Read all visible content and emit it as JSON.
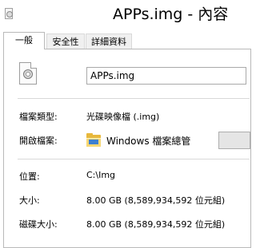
{
  "window": {
    "title": "APPs.img - 內容"
  },
  "tabs": [
    {
      "label": "一般",
      "active": true
    },
    {
      "label": "安全性",
      "active": false
    },
    {
      "label": "詳細資料",
      "active": false
    }
  ],
  "file": {
    "name": "APPs.img",
    "icon": "disc-image-file-icon"
  },
  "properties": {
    "type_label": "檔案類型:",
    "type_value": "光碟映像檔 (.img)",
    "opens_with_label": "開啟檔案:",
    "opens_with_value": "Windows 檔案總管",
    "opens_with_icon": "file-explorer-icon",
    "location_label": "位置:",
    "location_value": "C:\\Img",
    "size_label": "大小:",
    "size_value": "8.00 GB (8,589,934,592 位元組)",
    "size_on_disk_label": "磁碟大小:",
    "size_on_disk_value": "8.00 GB (8,589,934,592 位元組)"
  }
}
